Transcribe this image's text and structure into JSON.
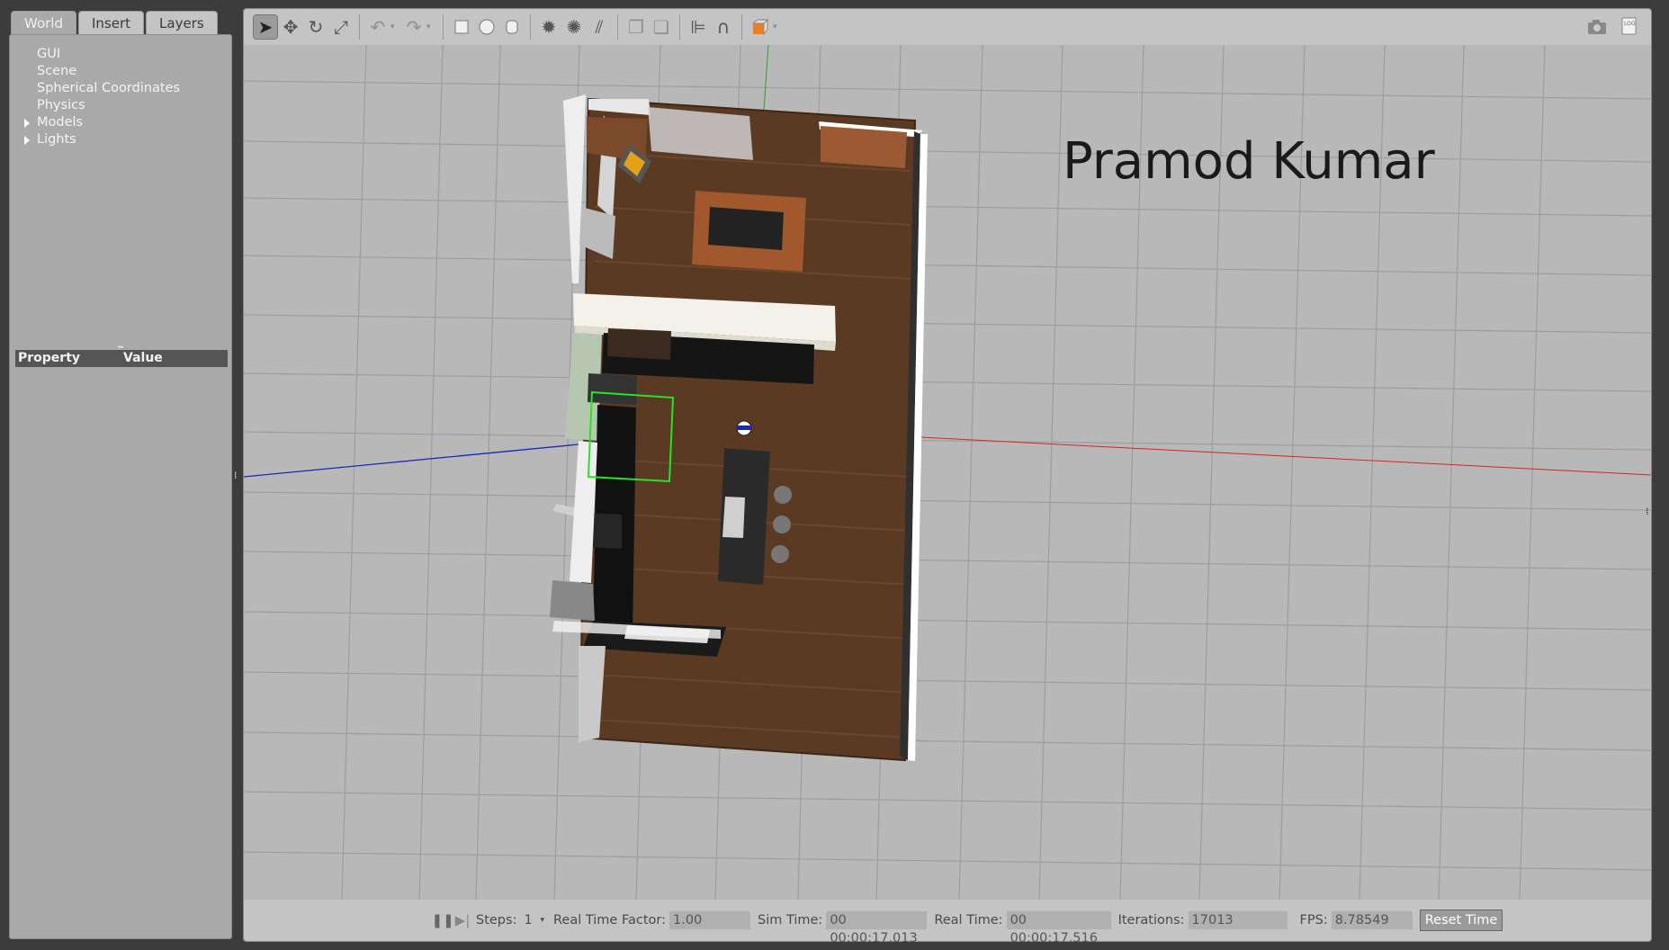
{
  "left_panel": {
    "tabs": [
      "World",
      "Insert",
      "Layers"
    ],
    "tree": [
      {
        "label": "GUI",
        "expandable": false
      },
      {
        "label": "Scene",
        "expandable": false
      },
      {
        "label": "Spherical Coordinates",
        "expandable": false
      },
      {
        "label": "Physics",
        "expandable": false
      },
      {
        "label": "Models",
        "expandable": true
      },
      {
        "label": "Lights",
        "expandable": true
      }
    ],
    "property_header": "Property",
    "value_header": "Value"
  },
  "toolbar": {
    "tools": [
      {
        "name": "select-mode-icon",
        "glyph": "➤"
      },
      {
        "name": "translate-mode-icon",
        "glyph": "✥"
      },
      {
        "name": "rotate-mode-icon",
        "glyph": "↻"
      },
      {
        "name": "scale-mode-icon",
        "glyph": "⤢"
      }
    ],
    "history": [
      {
        "name": "undo-icon",
        "glyph": "↶"
      },
      {
        "name": "redo-icon",
        "glyph": "↷"
      }
    ],
    "shapes": [
      {
        "name": "box-shape-icon",
        "glyph": "■"
      },
      {
        "name": "sphere-shape-icon",
        "glyph": "●"
      },
      {
        "name": "cylinder-shape-icon",
        "glyph": "▮"
      }
    ],
    "lights": [
      {
        "name": "point-light-icon",
        "glyph": "✹"
      },
      {
        "name": "spot-light-icon",
        "glyph": "✺"
      },
      {
        "name": "directional-light-icon",
        "glyph": "⫽"
      }
    ],
    "edit": [
      {
        "name": "copy-icon",
        "glyph": "❐"
      },
      {
        "name": "paste-icon",
        "glyph": "❏"
      }
    ],
    "align": [
      {
        "name": "align-icon",
        "glyph": "⊫"
      },
      {
        "name": "snap-icon",
        "glyph": "∩"
      }
    ],
    "view_angle_color": "#f07d1e",
    "right": [
      {
        "name": "screenshot-icon",
        "glyph": "📷"
      },
      {
        "name": "log-icon",
        "glyph": "▤"
      }
    ]
  },
  "viewport": {
    "overlay_text": "Pramod Kumar",
    "background_color": "#b8b8b8",
    "floor_color": "#5a3a22"
  },
  "bottom_bar": {
    "steps_label": "Steps:",
    "steps_value": "1",
    "rtf_label": "Real Time Factor:",
    "rtf_value": "1.00",
    "sim_time_label": "Sim Time:",
    "sim_time_value": "00 00:00:17.013",
    "real_time_label": "Real Time:",
    "real_time_value": "00 00:00:17.516",
    "iterations_label": "Iterations:",
    "iterations_value": "17013",
    "fps_label": "FPS:",
    "fps_value": "8.78549",
    "reset_label": "Reset Time"
  }
}
